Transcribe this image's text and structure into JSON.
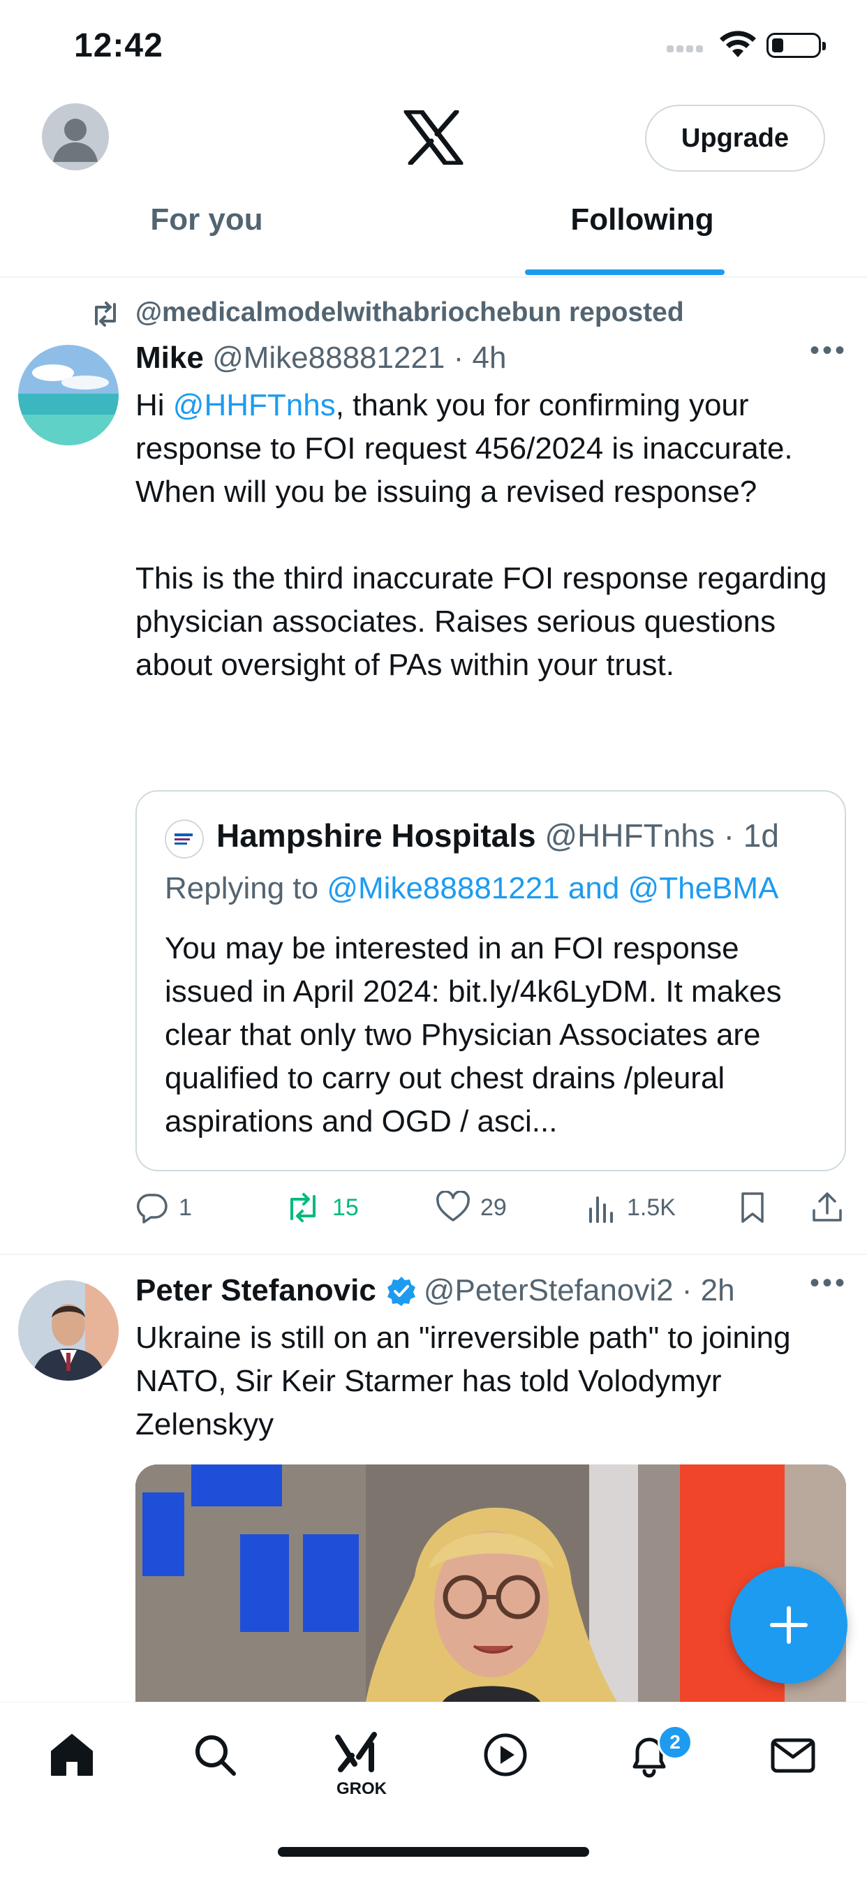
{
  "status": {
    "time": "12:42"
  },
  "header": {
    "upgrade_label": "Upgrade"
  },
  "tabs": [
    {
      "label": "For you",
      "active": false
    },
    {
      "label": "Following",
      "active": true
    }
  ],
  "tweets": [
    {
      "repost_label": "@medicalmodelwithabriochebun reposted",
      "name": "Mike",
      "handle_time": "@Mike88881221 · 4h",
      "body_prefix": "Hi ",
      "body_mention": "@HHFTnhs",
      "body_rest": ", thank you for confirming your response to FOI request 456/2024 is inaccurate. When will you be issuing a revised response?",
      "body_para2": "This is the third inaccurate FOI response regarding physician associates. Raises serious questions about oversight of PAs within your trust.",
      "quote": {
        "name": "Hampshire Hospitals",
        "handle_time": "@HHFTnhs · 1d",
        "reply_prefix": "Replying to ",
        "reply_targets": "@Mike88881221 and @TheBMA",
        "body": "You may be interested in an FOI response issued in April 2024: bit.ly/4k6LyDM. It makes clear that only two Physician Associates are qualified to carry out chest drains /pleural aspirations and OGD / asci..."
      },
      "actions": {
        "replies": "1",
        "reposts": "15",
        "likes": "29",
        "views": "1.5K"
      }
    },
    {
      "name": "Peter Stefanovic",
      "handle_time": "@PeterStefanovi2 · 2h",
      "verified": true,
      "body": "Ukraine is still on an \"irreversible path\" to joining NATO, Sir Keir Starmer has told Volodymyr Zelenskyy"
    }
  ],
  "bottom_nav": {
    "grok_label": "GROK",
    "notifications_count": "2"
  },
  "colors": {
    "accent": "#1d9bf0",
    "repost_active": "#00ba7c",
    "muted": "#536471"
  }
}
